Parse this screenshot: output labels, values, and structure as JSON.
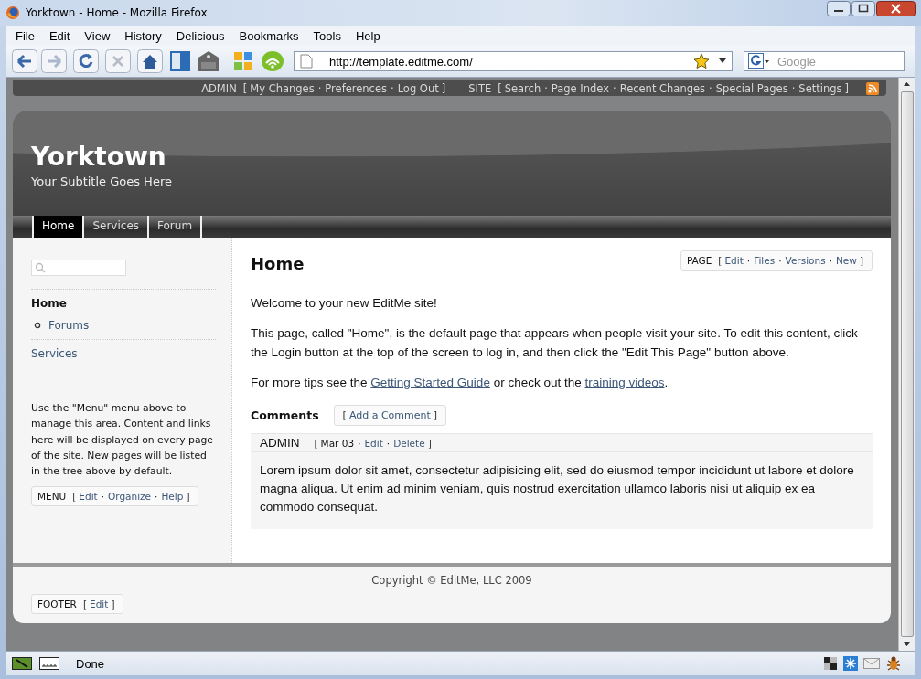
{
  "window": {
    "title": "Yorktown - Home - Mozilla Firefox"
  },
  "menu": [
    {
      "label": "File"
    },
    {
      "label": "Edit"
    },
    {
      "label": "View"
    },
    {
      "label": "History"
    },
    {
      "label": "Delicious"
    },
    {
      "label": "Bookmarks"
    },
    {
      "label": "Tools"
    },
    {
      "label": "Help"
    }
  ],
  "toolbar": {
    "url": "http://template.editme.com/",
    "search_placeholder": "Google"
  },
  "admin_bar": [
    {
      "label": "ADMIN",
      "open": "[",
      "links": [
        {
          "text": "My Changes"
        },
        {
          "sep": "·",
          "text": "Preferences"
        },
        {
          "sep": "·",
          "text": "Log Out"
        }
      ],
      "close": "]"
    },
    {
      "label": "SITE",
      "open": "[",
      "links": [
        {
          "text": "Search"
        },
        {
          "sep": "·",
          "text": "Page Index"
        },
        {
          "sep": "·",
          "text": "Recent Changes"
        },
        {
          "sep": "·",
          "text": "Special Pages"
        },
        {
          "sep": "·",
          "text": "Settings"
        }
      ],
      "close": "]"
    }
  ],
  "header": {
    "title": "Yorktown",
    "subtitle": "Your Subtitle Goes Here"
  },
  "tabs": [
    {
      "label": "Home",
      "selected": true
    },
    {
      "label": "Services",
      "selected": false
    },
    {
      "label": "Forum",
      "selected": false
    }
  ],
  "sidebar": {
    "tree": [
      {
        "label": "Home",
        "selected": true,
        "children": [
          {
            "label": "Forums",
            "selected": false
          }
        ]
      },
      {
        "label": "Services",
        "selected": false
      }
    ],
    "note": "Use the \"Menu\" menu above to manage this area. Content and links here will be displayed on every page of the site. New pages will be listed in the tree above by default.",
    "menu_box": {
      "label": "MENU",
      "open": "[",
      "links": [
        {
          "text": "Edit"
        },
        {
          "sep": "·",
          "text": "Organize"
        },
        {
          "sep": "·",
          "text": "Help"
        }
      ],
      "close": "]"
    }
  },
  "content": {
    "title": "Home",
    "page_box": {
      "label": "PAGE",
      "open": "[",
      "links": [
        {
          "text": "Edit"
        },
        {
          "sep": "·",
          "text": "Files"
        },
        {
          "sep": "·",
          "text": "Versions"
        },
        {
          "sep": "·",
          "text": "New"
        }
      ],
      "close": "]"
    },
    "paragraphs": [
      [
        {
          "kind": "text",
          "text": "Welcome to your new EditMe site!"
        }
      ],
      [
        {
          "kind": "text",
          "text": "This page, called \"Home\", is the default page that appears when people visit your site. To edit this content, click the Login button at the top of the screen to log in, and then click the \"Edit This Page\" button above."
        }
      ],
      [
        {
          "kind": "text",
          "text": "For more tips see the "
        },
        {
          "kind": "link",
          "text": "Getting Started Guide"
        },
        {
          "kind": "text",
          "text": " or check out the "
        },
        {
          "kind": "link",
          "text": "training videos"
        },
        {
          "kind": "text",
          "text": "."
        }
      ]
    ],
    "comments": {
      "title": "Comments",
      "add_button": {
        "open": "[",
        "text": "Add a Comment",
        "close": "]"
      },
      "items": [
        {
          "author": "ADMIN",
          "open": "[",
          "date": "Mar 03",
          "links": [
            {
              "sep": "·",
              "text": "Edit"
            },
            {
              "sep": "·",
              "text": "Delete"
            }
          ],
          "close": "]",
          "body": "Lorem ipsum dolor sit amet, consectetur adipisicing elit, sed do eiusmod tempor incididunt ut labore et dolore magna aliqua. Ut enim ad minim veniam, quis nostrud exercitation ullamco laboris nisi ut aliquip ex ea commodo consequat."
        }
      ]
    }
  },
  "footer": {
    "copyright": "Copyright © EditMe, LLC 2009",
    "footer_box": {
      "label": "FOOTER",
      "open": "[",
      "links": [
        {
          "text": "Edit"
        }
      ],
      "close": "]"
    }
  },
  "status_bar": {
    "text": "Done"
  }
}
